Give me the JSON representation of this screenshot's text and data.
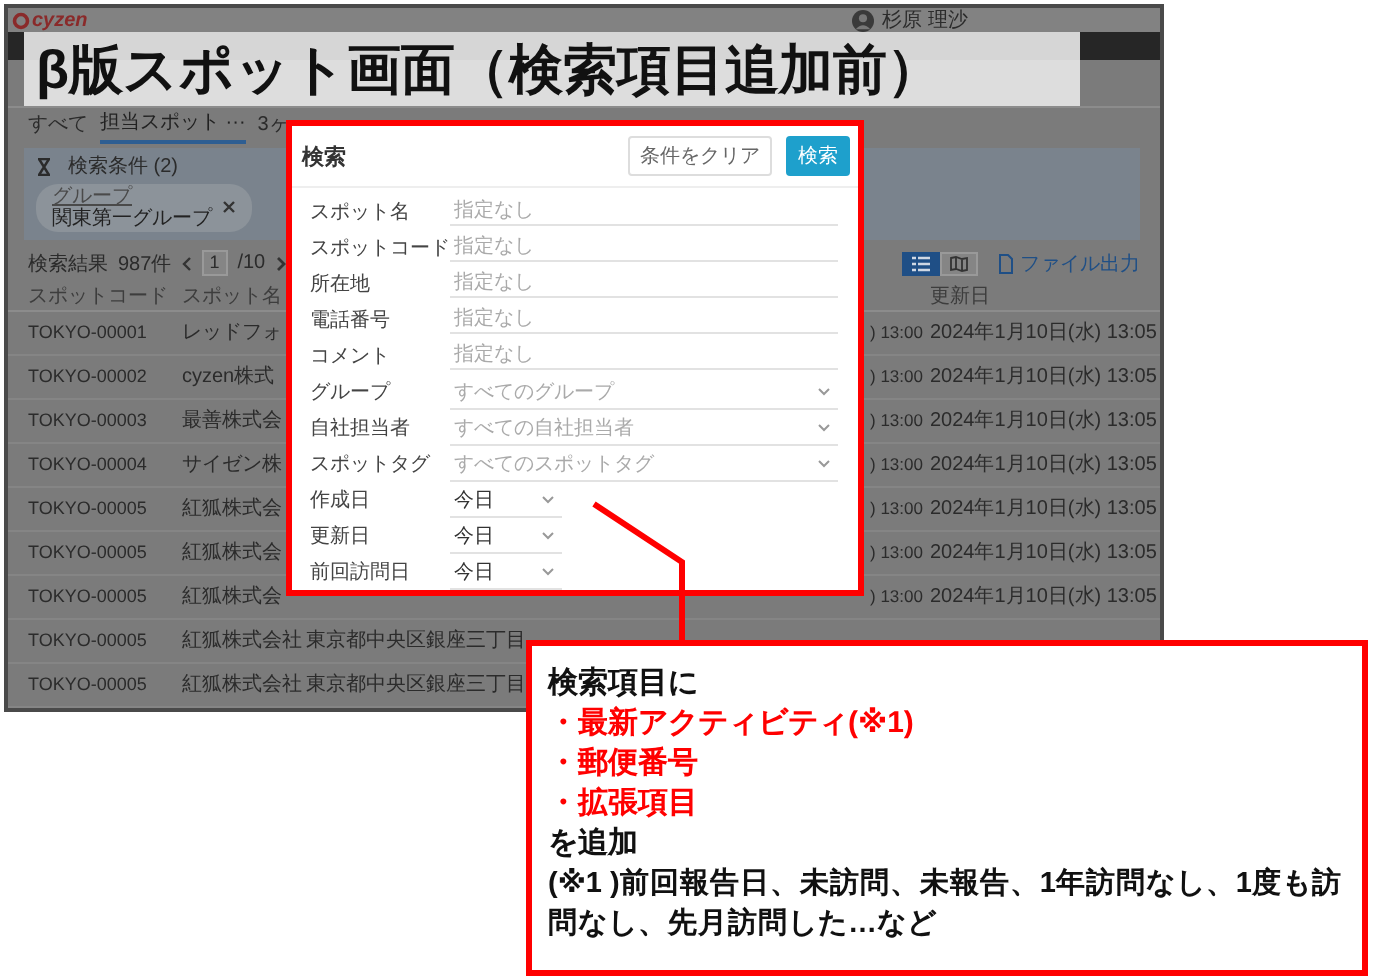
{
  "title_banner": "β版スポット画面（検索項目追加前）",
  "app": {
    "logo": "cyzen",
    "user_name": "杉原 理沙",
    "tabs": [
      {
        "label": "すべて",
        "selected": false
      },
      {
        "label": "担当スポット ···",
        "selected": true
      },
      {
        "label": "3ヶ",
        "selected": false
      }
    ],
    "filter": {
      "title": "検索条件 (2)",
      "chips": [
        {
          "label": "グループ",
          "value": "関東第一グループ"
        }
      ]
    },
    "results": {
      "label": "検索結果",
      "count": "987件",
      "page": "1",
      "pages": "/10",
      "export": "ファイル出力",
      "view_toggle": [
        {
          "kind": "list",
          "selected": true
        },
        {
          "kind": "map",
          "selected": false
        }
      ]
    },
    "table": {
      "columns": {
        "code": "スポットコード",
        "name": "スポット名",
        "updated": "更新日"
      },
      "rows": [
        {
          "code": "TOKYO-00001",
          "name": "レッドフォ",
          "created": ") 13:00",
          "updated": "2024年1月10日(水) 13:05"
        },
        {
          "code": "TOKYO-00002",
          "name": "cyzen株式",
          "created": ") 13:00",
          "updated": "2024年1月10日(水) 13:05"
        },
        {
          "code": "TOKYO-00003",
          "name": "最善株式会",
          "created": ") 13:00",
          "updated": "2024年1月10日(水) 13:05"
        },
        {
          "code": "TOKYO-00004",
          "name": "サイゼン株",
          "created": ") 13:00",
          "updated": "2024年1月10日(水) 13:05"
        },
        {
          "code": "TOKYO-00005",
          "name": "紅狐株式会",
          "created": ") 13:00",
          "updated": "2024年1月10日(水) 13:05"
        },
        {
          "code": "TOKYO-00005",
          "name": "紅狐株式会",
          "created": ") 13:00",
          "updated": "2024年1月10日(水) 13:05"
        },
        {
          "code": "TOKYO-00005",
          "name": "紅狐株式会",
          "created": ") 13:00",
          "updated": "2024年1月10日(水) 13:05"
        },
        {
          "code": "TOKYO-00005",
          "name": "紅狐株式会社",
          "address": "東京都中央区銀座三丁目"
        },
        {
          "code": "TOKYO-00005",
          "name": "紅狐株式会社",
          "address": "東京都中央区銀座三丁目"
        }
      ]
    }
  },
  "search_dialog": {
    "title": "検索",
    "clear_button": "条件をクリア",
    "search_button": "検索",
    "fields": [
      {
        "label": "スポット名",
        "kind": "text",
        "placeholder": "指定なし"
      },
      {
        "label": "スポットコード",
        "kind": "text",
        "placeholder": "指定なし"
      },
      {
        "label": "所在地",
        "kind": "text",
        "placeholder": "指定なし"
      },
      {
        "label": "電話番号",
        "kind": "text",
        "placeholder": "指定なし"
      },
      {
        "label": "コメント",
        "kind": "text",
        "placeholder": "指定なし"
      },
      {
        "label": "グループ",
        "kind": "select",
        "placeholder": "すべてのグループ"
      },
      {
        "label": "自社担当者",
        "kind": "select",
        "placeholder": "すべての自社担当者"
      },
      {
        "label": "スポットタグ",
        "kind": "select",
        "placeholder": "すべてのスポットタグ"
      },
      {
        "label": "作成日",
        "kind": "date",
        "value": "今日"
      },
      {
        "label": "更新日",
        "kind": "date",
        "value": "今日"
      },
      {
        "label": "前回訪問日",
        "kind": "date",
        "value": "今日"
      }
    ]
  },
  "callout": {
    "lines": [
      {
        "text": "検索項目に",
        "color": "#111111"
      },
      {
        "text": "・最新アクティビティ(※1)",
        "color": "#ff0000"
      },
      {
        "text": "・郵便番号",
        "color": "#ff0000"
      },
      {
        "text": "・拡張項目",
        "color": "#ff0000"
      },
      {
        "text": "を追加",
        "color": "#111111"
      }
    ],
    "note": "(※1 )前回報告日、未訪問、未報告、1年訪問なし、1度も訪問なし、先月訪問した…など"
  }
}
